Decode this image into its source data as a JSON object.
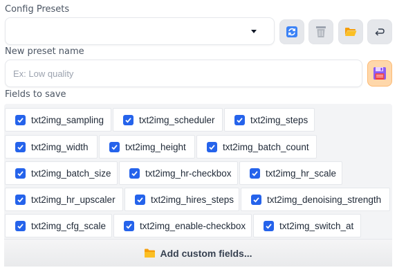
{
  "presets": {
    "label": "Config Presets",
    "selected": ""
  },
  "toolbar": {
    "refresh_icon": "refresh-icon",
    "delete_icon": "trash-icon",
    "open_folder_icon": "folder-open-icon",
    "undo_icon": "undo-arrow-icon"
  },
  "new_preset": {
    "label": "New preset name",
    "placeholder": "Ex: Low quality",
    "value": "",
    "save_icon": "floppy-disk-icon"
  },
  "fields": {
    "label": "Fields to save",
    "items": [
      {
        "label": "txt2img_sampling",
        "checked": true
      },
      {
        "label": "txt2img_scheduler",
        "checked": true
      },
      {
        "label": "txt2img_steps",
        "checked": true
      },
      {
        "label": "txt2img_width",
        "checked": true
      },
      {
        "label": "txt2img_height",
        "checked": true
      },
      {
        "label": "txt2img_batch_count",
        "checked": true
      },
      {
        "label": "txt2img_batch_size",
        "checked": true
      },
      {
        "label": "txt2img_hr-checkbox",
        "checked": true
      },
      {
        "label": "txt2img_hr_scale",
        "checked": true
      },
      {
        "label": "txt2img_hr_upscaler",
        "checked": true
      },
      {
        "label": "txt2img_hires_steps",
        "checked": true
      },
      {
        "label": "txt2img_denoising_strength",
        "checked": true
      },
      {
        "label": "txt2img_cfg_scale",
        "checked": true
      },
      {
        "label": "txt2img_enable-checkbox",
        "checked": true
      },
      {
        "label": "txt2img_switch_at",
        "checked": true
      }
    ]
  },
  "add_custom": {
    "label": "Add custom fields...",
    "icon": "folder-icon"
  },
  "colors": {
    "checkbox": "#2563eb",
    "save_button": "#fed7aa",
    "panel_bg": "#f3f4f6"
  }
}
